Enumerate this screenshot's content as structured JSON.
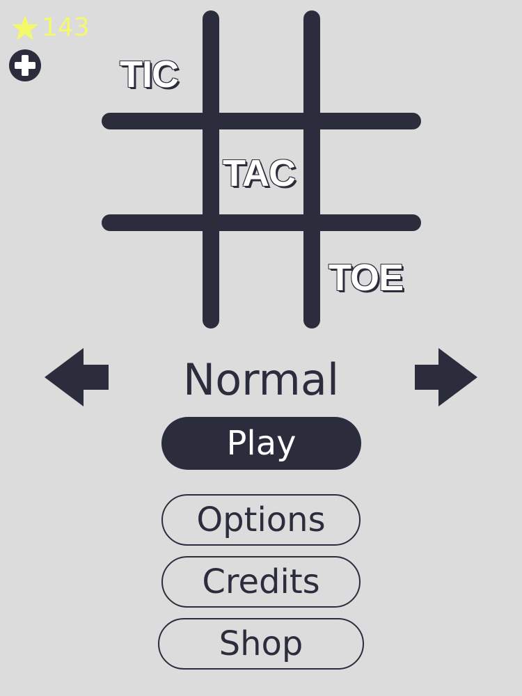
{
  "currency": {
    "stars": "143",
    "star_color": "#f4f96a",
    "icon": "star-icon"
  },
  "add_currency": {
    "icon": "plus-circle-icon"
  },
  "logo": {
    "word1": "TIC",
    "word2": "TAC",
    "word3": "TOE"
  },
  "mode_selector": {
    "current_mode": "Normal",
    "prev_icon": "arrow-left-icon",
    "next_icon": "arrow-right-icon"
  },
  "menu": {
    "play": "Play",
    "options": "Options",
    "credits": "Credits",
    "shop": "Shop"
  },
  "colors": {
    "background": "#dcdcdc",
    "ink": "#2b2d3c",
    "accent": "#f4f96a"
  }
}
